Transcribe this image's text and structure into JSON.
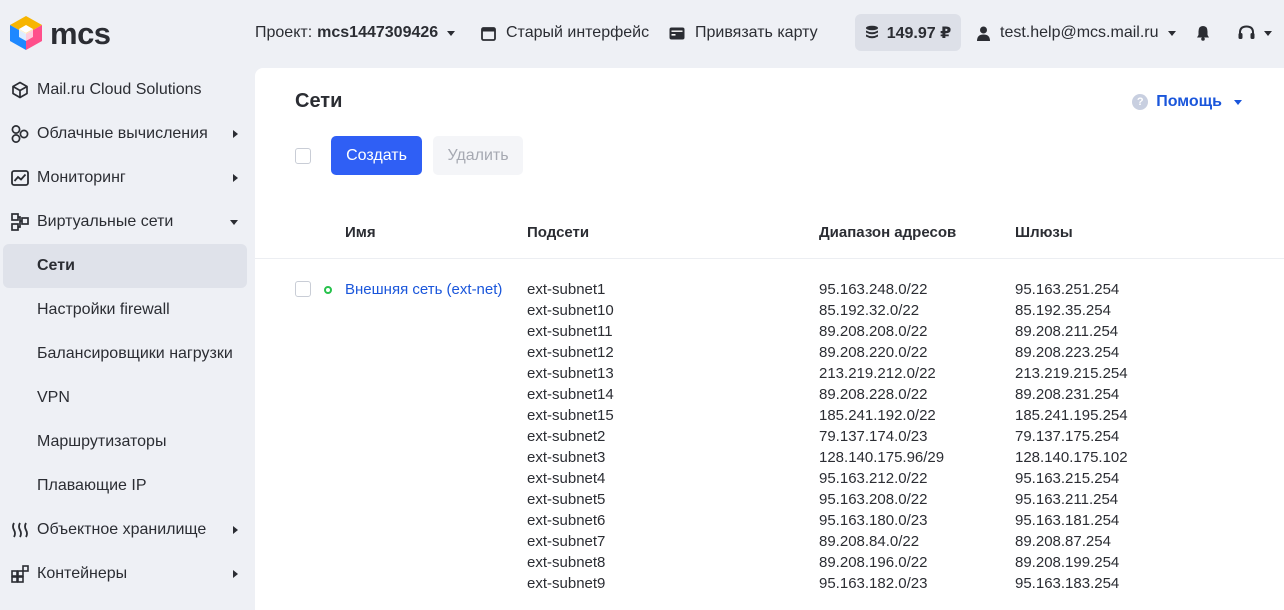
{
  "header": {
    "logo_text": "mcs",
    "project_label": "Проект:",
    "project_value": "mcs1447309426",
    "old_interface": "Старый интерфейс",
    "bind_card": "Привязать карту",
    "balance": "149.97 ₽",
    "user_email": "test.help@mcs.mail.ru"
  },
  "sidebar": {
    "items": [
      {
        "label": "Mail.ru Cloud Solutions",
        "icon": "cube-icon"
      },
      {
        "label": "Облачные вычисления",
        "icon": "hexagons-icon"
      },
      {
        "label": "Мониторинг",
        "icon": "chart-icon"
      },
      {
        "label": "Виртуальные сети",
        "icon": "network-icon"
      },
      {
        "label": "Сети"
      },
      {
        "label": "Настройки firewall"
      },
      {
        "label": "Балансировщики нагрузки"
      },
      {
        "label": "VPN"
      },
      {
        "label": "Маршрутизаторы"
      },
      {
        "label": "Плавающие IP"
      },
      {
        "label": "Объектное хранилище",
        "icon": "storage-icon"
      },
      {
        "label": "Контейнеры",
        "icon": "containers-icon"
      }
    ]
  },
  "main": {
    "title": "Сети",
    "help": "Помощь",
    "create_button": "Создать",
    "delete_button": "Удалить",
    "columns": [
      "Имя",
      "Подсети",
      "Диапазон адресов",
      "Шлюзы"
    ],
    "network": {
      "name": "Внешняя сеть (ext-net)",
      "status": "active",
      "subnets": [
        "ext-subnet1",
        "ext-subnet10",
        "ext-subnet11",
        "ext-subnet12",
        "ext-subnet13",
        "ext-subnet14",
        "ext-subnet15",
        "ext-subnet2",
        "ext-subnet3",
        "ext-subnet4",
        "ext-subnet5",
        "ext-subnet6",
        "ext-subnet7",
        "ext-subnet8",
        "ext-subnet9"
      ],
      "ranges": [
        "95.163.248.0/22",
        "85.192.32.0/22",
        "89.208.208.0/22",
        "89.208.220.0/22",
        "213.219.212.0/22",
        "89.208.228.0/22",
        "185.241.192.0/22",
        "79.137.174.0/23",
        "128.140.175.96/29",
        "95.163.212.0/22",
        "95.163.208.0/22",
        "95.163.180.0/23",
        "89.208.84.0/22",
        "89.208.196.0/22",
        "95.163.182.0/23"
      ],
      "gateways": [
        "95.163.251.254",
        "85.192.35.254",
        "89.208.211.254",
        "89.208.223.254",
        "213.219.215.254",
        "89.208.231.254",
        "185.241.195.254",
        "79.137.175.254",
        "128.140.175.102",
        "95.163.215.254",
        "95.163.211.254",
        "95.163.181.254",
        "89.208.87.254",
        "89.208.199.254",
        "95.163.183.254"
      ]
    }
  },
  "colors": {
    "accent": "#2f5ff5",
    "link": "#1a56db",
    "status_active": "#27c24c",
    "background": "#eef0f5"
  }
}
